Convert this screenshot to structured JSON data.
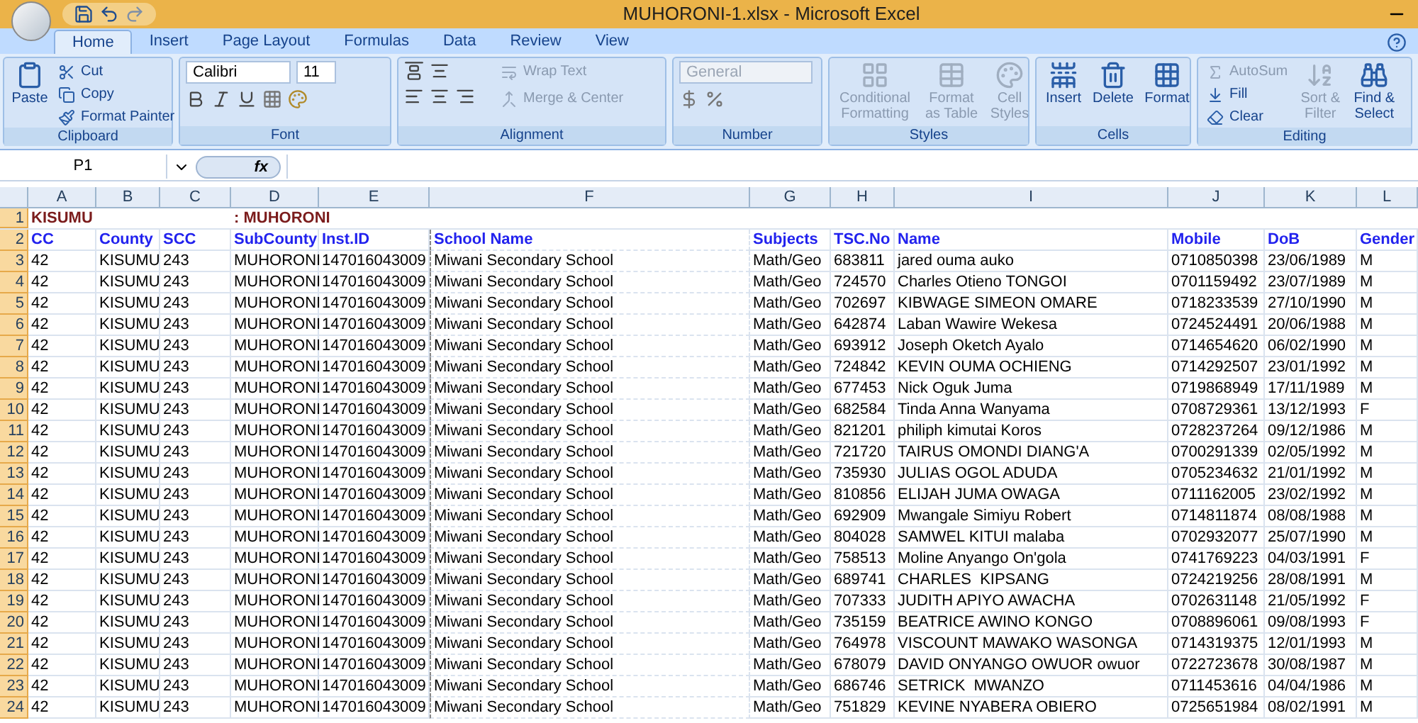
{
  "window": {
    "title": "MUHORONI-1.xlsx - Microsoft Excel"
  },
  "tabs": [
    {
      "label": "Home",
      "selected": true
    },
    {
      "label": "Insert",
      "selected": false
    },
    {
      "label": "Page Layout",
      "selected": false
    },
    {
      "label": "Formulas",
      "selected": false
    },
    {
      "label": "Data",
      "selected": false
    },
    {
      "label": "Review",
      "selected": false
    },
    {
      "label": "View",
      "selected": false
    }
  ],
  "ribbon": {
    "clipboard": {
      "label": "Clipboard",
      "paste": "Paste",
      "cut": "Cut",
      "copy": "Copy",
      "format_painter": "Format Painter"
    },
    "font": {
      "label": "Font",
      "font_name": "Calibri",
      "font_size": "11"
    },
    "alignment": {
      "label": "Alignment",
      "wrap_text": "Wrap Text",
      "merge_center": "Merge & Center"
    },
    "number": {
      "label": "Number",
      "format": "General",
      "disabled": true
    },
    "styles": {
      "label": "Styles",
      "buttons": [
        {
          "label": "Conditional Formatting",
          "disabled": true
        },
        {
          "label": "Format as Table",
          "disabled": true
        },
        {
          "label": "Cell Styles",
          "disabled": true
        }
      ]
    },
    "cells": {
      "label": "Cells",
      "buttons": [
        {
          "label": "Insert",
          "disabled": false
        },
        {
          "label": "Delete",
          "disabled": false
        },
        {
          "label": "Format",
          "disabled": false
        }
      ]
    },
    "editing": {
      "label": "Editing",
      "autosum": {
        "label": "AutoSum",
        "disabled": true
      },
      "fill": {
        "label": "Fill",
        "disabled": false
      },
      "clear": {
        "label": "Clear",
        "disabled": false
      },
      "sort_filter": {
        "label": "Sort & Filter",
        "disabled": true
      },
      "find_select": {
        "label": "Find & Select",
        "disabled": false
      }
    }
  },
  "formula_bar": {
    "name_box": "P1",
    "fx": "fx"
  },
  "columns": [
    "A",
    "B",
    "C",
    "D",
    "E",
    "F",
    "G",
    "H",
    "I",
    "J",
    "K",
    "L"
  ],
  "rows": [
    {
      "number": "1",
      "kind": "title",
      "county": "KISUMU",
      "subcounty": ": MUHORONI"
    },
    {
      "number": "2",
      "kind": "header",
      "cells": [
        "CC",
        "County",
        "SCC",
        "SubCounty",
        "Inst.ID",
        "School Name",
        "Subjects",
        "TSC.No",
        "Name",
        "Mobile",
        "DoB",
        "Gender"
      ]
    },
    {
      "number": "3",
      "kind": "data",
      "cells": [
        "42",
        "KISUMU",
        "243",
        "MUHORONI",
        "147016043009",
        "Miwani Secondary School",
        "Math/Geo",
        "683811",
        "jared ouma auko",
        "0710850398",
        "23/06/1989",
        "M"
      ]
    },
    {
      "number": "4",
      "kind": "data",
      "cells": [
        "42",
        "KISUMU",
        "243",
        "MUHORONI",
        "147016043009",
        "Miwani Secondary School",
        "Math/Geo",
        "724570",
        "Charles Otieno TONGOI",
        "0701159492",
        "23/07/1989",
        "M"
      ]
    },
    {
      "number": "5",
      "kind": "data",
      "cells": [
        "42",
        "KISUMU",
        "243",
        "MUHORONI",
        "147016043009",
        "Miwani Secondary School",
        "Math/Geo",
        "702697",
        "KIBWAGE SIMEON OMARE",
        "0718233539",
        "27/10/1990",
        "M"
      ]
    },
    {
      "number": "6",
      "kind": "data",
      "cells": [
        "42",
        "KISUMU",
        "243",
        "MUHORONI",
        "147016043009",
        "Miwani Secondary School",
        "Math/Geo",
        "642874",
        "Laban Wawire Wekesa",
        "0724524491",
        "20/06/1988",
        "M"
      ]
    },
    {
      "number": "7",
      "kind": "data",
      "cells": [
        "42",
        "KISUMU",
        "243",
        "MUHORONI",
        "147016043009",
        "Miwani Secondary School",
        "Math/Geo",
        "693912",
        "Joseph Oketch Ayalo",
        "0714654620",
        "06/02/1990",
        "M"
      ]
    },
    {
      "number": "8",
      "kind": "data",
      "cells": [
        "42",
        "KISUMU",
        "243",
        "MUHORONI",
        "147016043009",
        "Miwani Secondary School",
        "Math/Geo",
        "724842",
        "KEVIN OUMA OCHIENG",
        "0714292507",
        "23/01/1992",
        "M"
      ]
    },
    {
      "number": "9",
      "kind": "data",
      "cells": [
        "42",
        "KISUMU",
        "243",
        "MUHORONI",
        "147016043009",
        "Miwani Secondary School",
        "Math/Geo",
        "677453",
        "Nick Oguk Juma",
        "0719868949",
        "17/11/1989",
        "M"
      ]
    },
    {
      "number": "10",
      "kind": "data",
      "cells": [
        "42",
        "KISUMU",
        "243",
        "MUHORONI",
        "147016043009",
        "Miwani Secondary School",
        "Math/Geo",
        "682584",
        "Tinda Anna Wanyama",
        "0708729361",
        "13/12/1993",
        "F"
      ]
    },
    {
      "number": "11",
      "kind": "data",
      "cells": [
        "42",
        "KISUMU",
        "243",
        "MUHORONI",
        "147016043009",
        "Miwani Secondary School",
        "Math/Geo",
        "821201",
        "philiph kimutai Koros",
        "0728237264",
        "09/12/1986",
        "M"
      ]
    },
    {
      "number": "12",
      "kind": "data",
      "cells": [
        "42",
        "KISUMU",
        "243",
        "MUHORONI",
        "147016043009",
        "Miwani Secondary School",
        "Math/Geo",
        "721720",
        "TAIRUS OMONDI DIANG'A",
        "0700291339",
        "02/05/1992",
        "M"
      ]
    },
    {
      "number": "13",
      "kind": "data",
      "cells": [
        "42",
        "KISUMU",
        "243",
        "MUHORONI",
        "147016043009",
        "Miwani Secondary School",
        "Math/Geo",
        "735930",
        "JULIAS OGOL ADUDA",
        "0705234632",
        "21/01/1992",
        "M"
      ]
    },
    {
      "number": "14",
      "kind": "data",
      "cells": [
        "42",
        "KISUMU",
        "243",
        "MUHORONI",
        "147016043009",
        "Miwani Secondary School",
        "Math/Geo",
        "810856",
        "ELIJAH JUMA OWAGA",
        "0711162005",
        "23/02/1992",
        "M"
      ]
    },
    {
      "number": "15",
      "kind": "data",
      "cells": [
        "42",
        "KISUMU",
        "243",
        "MUHORONI",
        "147016043009",
        "Miwani Secondary School",
        "Math/Geo",
        "692909",
        "Mwangale Simiyu Robert",
        "0714811874",
        "08/08/1988",
        "M"
      ]
    },
    {
      "number": "16",
      "kind": "data",
      "cells": [
        "42",
        "KISUMU",
        "243",
        "MUHORONI",
        "147016043009",
        "Miwani Secondary School",
        "Math/Geo",
        "804028",
        "SAMWEL KITUI malaba",
        "0702932077",
        "25/07/1990",
        "M"
      ]
    },
    {
      "number": "17",
      "kind": "data",
      "cells": [
        "42",
        "KISUMU",
        "243",
        "MUHORONI",
        "147016043009",
        "Miwani Secondary School",
        "Math/Geo",
        "758513",
        "Moline Anyango On'gola",
        "0741769223",
        "04/03/1991",
        "F"
      ]
    },
    {
      "number": "18",
      "kind": "data",
      "cells": [
        "42",
        "KISUMU",
        "243",
        "MUHORONI",
        "147016043009",
        "Miwani Secondary School",
        "Math/Geo",
        "689741",
        "CHARLES  KIPSANG",
        "0724219256",
        "28/08/1991",
        "M"
      ]
    },
    {
      "number": "19",
      "kind": "data",
      "cells": [
        "42",
        "KISUMU",
        "243",
        "MUHORONI",
        "147016043009",
        "Miwani Secondary School",
        "Math/Geo",
        "707333",
        "JUDITH APIYO AWACHA",
        "0702631148",
        "21/05/1992",
        "F"
      ]
    },
    {
      "number": "20",
      "kind": "data",
      "cells": [
        "42",
        "KISUMU",
        "243",
        "MUHORONI",
        "147016043009",
        "Miwani Secondary School",
        "Math/Geo",
        "735159",
        "BEATRICE AWINO KONGO",
        "0708896061",
        "09/08/1993",
        "F"
      ]
    },
    {
      "number": "21",
      "kind": "data",
      "cells": [
        "42",
        "KISUMU",
        "243",
        "MUHORONI",
        "147016043009",
        "Miwani Secondary School",
        "Math/Geo",
        "764978",
        "VISCOUNT MAWAKO WASONGA",
        "0714319375",
        "12/01/1993",
        "M"
      ]
    },
    {
      "number": "22",
      "kind": "data",
      "cells": [
        "42",
        "KISUMU",
        "243",
        "MUHORONI",
        "147016043009",
        "Miwani Secondary School",
        "Math/Geo",
        "678079",
        "DAVID ONYANGO OWUOR owuor",
        "0722723678",
        "30/08/1987",
        "M"
      ]
    },
    {
      "number": "23",
      "kind": "data",
      "cells": [
        "42",
        "KISUMU",
        "243",
        "MUHORONI",
        "147016043009",
        "Miwani Secondary School",
        "Math/Geo",
        "686746",
        "SETRICK  MWANZO",
        "0711453616",
        "04/04/1986",
        "M"
      ]
    },
    {
      "number": "24",
      "kind": "data",
      "cells": [
        "42",
        "KISUMU",
        "243",
        "MUHORONI",
        "147016043009",
        "Miwani Secondary School",
        "Math/Geo",
        "751829",
        "KEVINE NYABERA OBIERO",
        "0725651984",
        "08/02/1991",
        "M"
      ]
    }
  ]
}
